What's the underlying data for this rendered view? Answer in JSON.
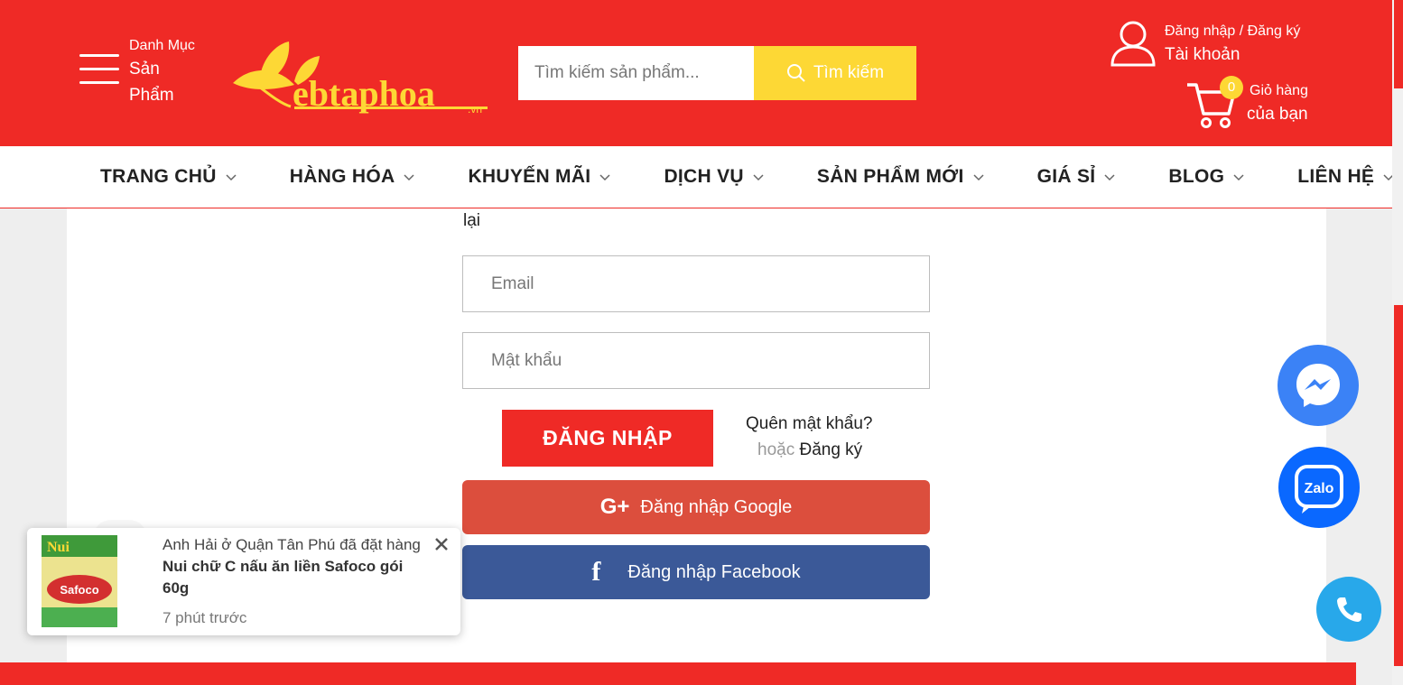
{
  "header": {
    "category_line1": "Danh Mục",
    "category_line2": "Sản Phẩm",
    "search_placeholder": "Tìm kiếm sản phẩm...",
    "search_button": "Tìm kiếm",
    "account_login": "Đăng nhập / Đăng ký",
    "account_label": "Tài khoản",
    "cart_count": "0",
    "cart_line1": "Giỏ hàng",
    "cart_line2": "của bạn"
  },
  "logo": {
    "text": "ebtaphoa",
    "suffix": ".vn"
  },
  "nav": {
    "items": [
      "TRANG CHỦ",
      "HÀNG HÓA",
      "KHUYẾN MÃI",
      "DỊCH VỤ",
      "SẢN PHẨM MỚI",
      "GIÁ SỈ",
      "BLOG",
      "LIÊN HỆ"
    ]
  },
  "form": {
    "partial_text": "lại",
    "email_placeholder": "Email",
    "password_placeholder": "Mật khẩu",
    "login_button": "ĐĂNG NHẬP",
    "forgot": "Quên mật khẩu?",
    "or": "hoặc",
    "register": "Đăng ký",
    "google_button": "Đăng nhập Google",
    "google_icon_text": "G+",
    "facebook_button": "Đăng nhập Facebook",
    "facebook_icon_text": "f"
  },
  "toast": {
    "prefix": "Anh Hải ở Quận Tân Phú đã đặt hàng",
    "product": "Nui chữ C nấu ăn liền Safoco gói 60g",
    "time": "7 phút trước",
    "image_brand": "Safoco",
    "image_label": "Nui"
  },
  "floating": {
    "zalo_label": "Zalo"
  },
  "colors": {
    "brand_red": "#ef2a26",
    "search_yellow": "#fdd835",
    "google_red": "#dc4e3d",
    "facebook_blue": "#3b5998",
    "messenger_blue": "#3b82f6",
    "zalo_blue": "#0a68ff",
    "phone_blue": "#28a8ea"
  }
}
